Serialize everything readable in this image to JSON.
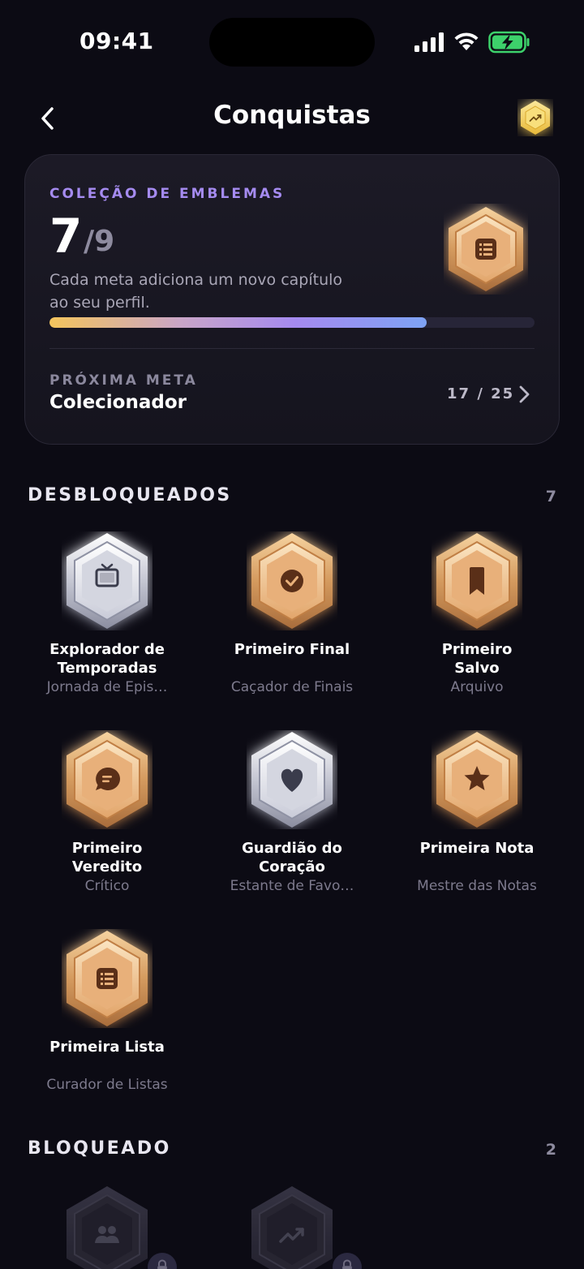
{
  "status": {
    "time": "09:41"
  },
  "nav": {
    "title": "Conquistas"
  },
  "summary": {
    "label": "COLEÇÃO DE EMBLEMAS",
    "count": "7",
    "total": "/9",
    "description": "Cada meta adiciona um novo capítulo ao seu perfil.",
    "progress_fraction": 0.778,
    "next_label": "PRÓXIMA META",
    "next_title": "Colecionador",
    "next_progress": "17 / 25"
  },
  "unlocked": {
    "title": "DESBLOQUEADOS",
    "count": "7",
    "badges": [
      {
        "name": "Explorador de Temporadas",
        "sub": "Jornada de Epis…",
        "tier": "silver",
        "icon": "tv-icon"
      },
      {
        "name": "Primeiro Final",
        "sub": "Caçador de Finais",
        "tier": "bronze",
        "icon": "check-circle-icon"
      },
      {
        "name": "Primeiro Salvo",
        "sub": "Arquivo",
        "tier": "bronze",
        "icon": "bookmark-icon"
      },
      {
        "name": "Primeiro Veredito",
        "sub": "Crítico",
        "tier": "bronze",
        "icon": "chat-icon"
      },
      {
        "name": "Guardião do Coração",
        "sub": "Estante de Favo…",
        "tier": "silver",
        "icon": "heart-icon"
      },
      {
        "name": "Primeira Nota",
        "sub": "Mestre das Notas",
        "tier": "bronze",
        "icon": "star-icon"
      },
      {
        "name": "Primeira Lista",
        "sub": "Curador de Listas",
        "tier": "bronze",
        "icon": "list-icon"
      }
    ]
  },
  "locked": {
    "title": "BLOQUEADO",
    "count": "2",
    "badges": [
      {
        "icon": "group-icon"
      },
      {
        "icon": "trend-up-icon"
      }
    ]
  },
  "colors": {
    "background": "#0c0b14",
    "accent_purple": "#a58bf0",
    "bronze": "#d9a068",
    "silver": "#c9cbd6",
    "gold": "#f5d76e"
  }
}
